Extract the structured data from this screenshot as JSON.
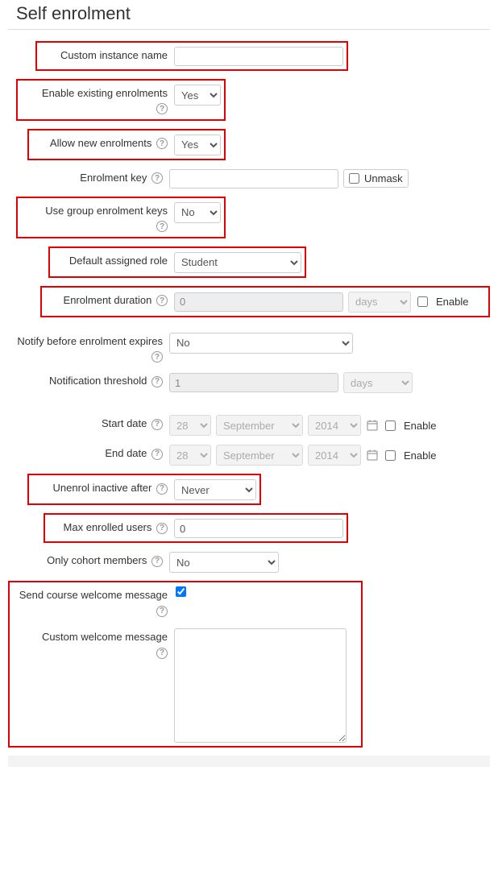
{
  "title": "Self enrolment",
  "rows": {
    "custom_name": {
      "label": "Custom instance name",
      "value": ""
    },
    "enable_existing": {
      "label": "Enable existing enrolments",
      "value": "Yes"
    },
    "allow_new": {
      "label": "Allow new enrolments",
      "value": "Yes"
    },
    "enrolment_key": {
      "label": "Enrolment key",
      "value": "",
      "unmask": "Unmask"
    },
    "group_keys": {
      "label": "Use group enrolment keys",
      "value": "No"
    },
    "default_role": {
      "label": "Default assigned role",
      "value": "Student"
    },
    "duration": {
      "label": "Enrolment duration",
      "value": "0",
      "unit": "days",
      "enable": "Enable"
    },
    "notify": {
      "label": "Notify before enrolment expires",
      "value": "No"
    },
    "threshold": {
      "label": "Notification threshold",
      "value": "1",
      "unit": "days"
    },
    "start_date": {
      "label": "Start date",
      "day": "28",
      "month": "September",
      "year": "2014",
      "enable": "Enable"
    },
    "end_date": {
      "label": "End date",
      "day": "28",
      "month": "September",
      "year": "2014",
      "enable": "Enable"
    },
    "unenrol": {
      "label": "Unenrol inactive after",
      "value": "Never"
    },
    "max_users": {
      "label": "Max enrolled users",
      "value": "0"
    },
    "cohort": {
      "label": "Only cohort members",
      "value": "No"
    },
    "welcome_check": {
      "label": "Send course welcome message"
    },
    "welcome_msg": {
      "label": "Custom welcome message",
      "value": ""
    }
  }
}
